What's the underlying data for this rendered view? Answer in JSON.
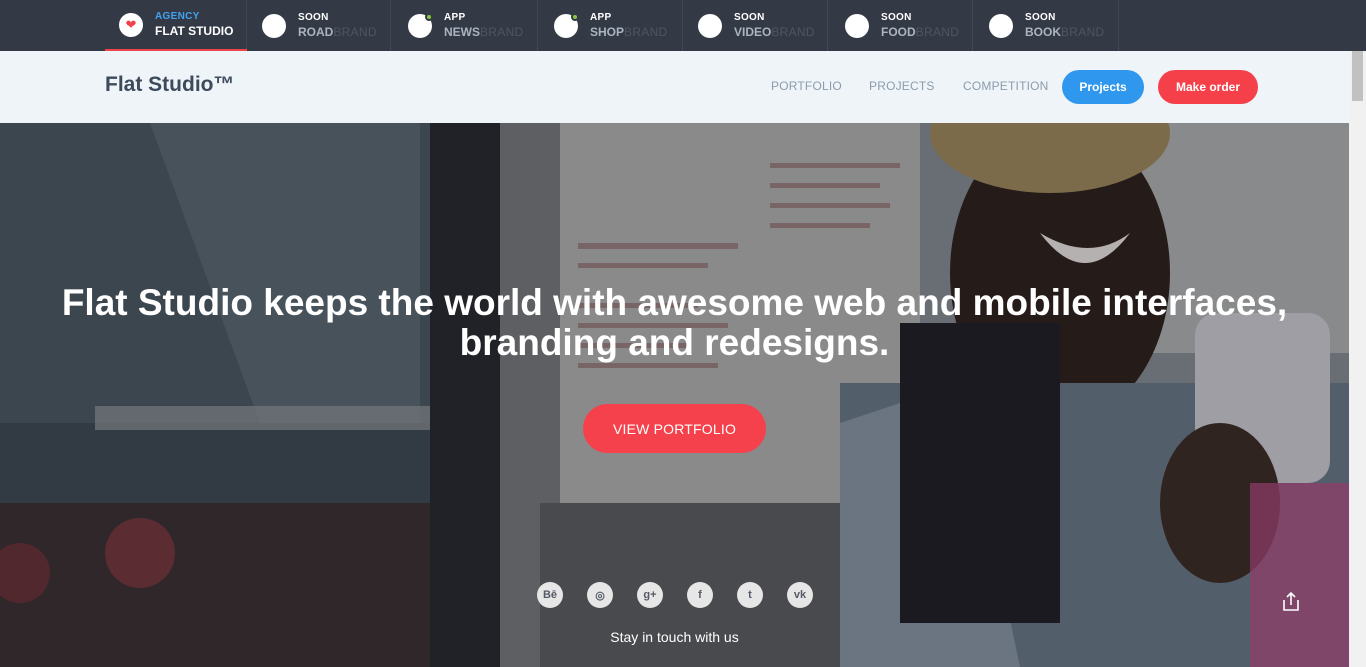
{
  "brand_tabs": [
    {
      "status": "AGENCY",
      "name1": "FLAT STUDIO",
      "name2": "",
      "active": true,
      "dot": false,
      "heart": true
    },
    {
      "status": "SOON",
      "name1": "ROAD",
      "name2": "BRAND",
      "active": false,
      "dot": false,
      "heart": false
    },
    {
      "status": "APP",
      "name1": "NEWS",
      "name2": "BRAND",
      "active": false,
      "dot": true,
      "heart": false
    },
    {
      "status": "APP",
      "name1": "SHOP",
      "name2": "BRAND",
      "active": false,
      "dot": true,
      "heart": false
    },
    {
      "status": "SOON",
      "name1": "VIDEO",
      "name2": "BRAND",
      "active": false,
      "dot": false,
      "heart": false
    },
    {
      "status": "SOON",
      "name1": "FOOD",
      "name2": "BRAND",
      "active": false,
      "dot": false,
      "heart": false
    },
    {
      "status": "SOON",
      "name1": "BOOK",
      "name2": "BRAND",
      "active": false,
      "dot": false,
      "heart": false
    }
  ],
  "header": {
    "logo": "Flat Studio™",
    "nav": [
      "PORTFOLIO",
      "PROJECTS",
      "COMPETITION"
    ],
    "projects_button": "Projects",
    "order_button": "Make order"
  },
  "hero": {
    "headline_line1": "Flat Studio keeps the world with awesome web and mobile interfaces,",
    "headline_line2": "branding and redesigns.",
    "cta": "VIEW PORTFOLIO",
    "social": [
      {
        "icon": "behance-icon",
        "glyph": "Bē"
      },
      {
        "icon": "dribbble-icon",
        "glyph": "◎"
      },
      {
        "icon": "google-plus-icon",
        "glyph": "g+"
      },
      {
        "icon": "facebook-icon",
        "glyph": "f"
      },
      {
        "icon": "twitter-icon",
        "glyph": "t"
      },
      {
        "icon": "vk-icon",
        "glyph": "vk"
      }
    ],
    "stay": "Stay in touch with us"
  },
  "colors": {
    "topbar": "#343a45",
    "accent_red": "#f5414b",
    "accent_blue": "#2f97ee",
    "active_dot": "#8cc63f"
  }
}
